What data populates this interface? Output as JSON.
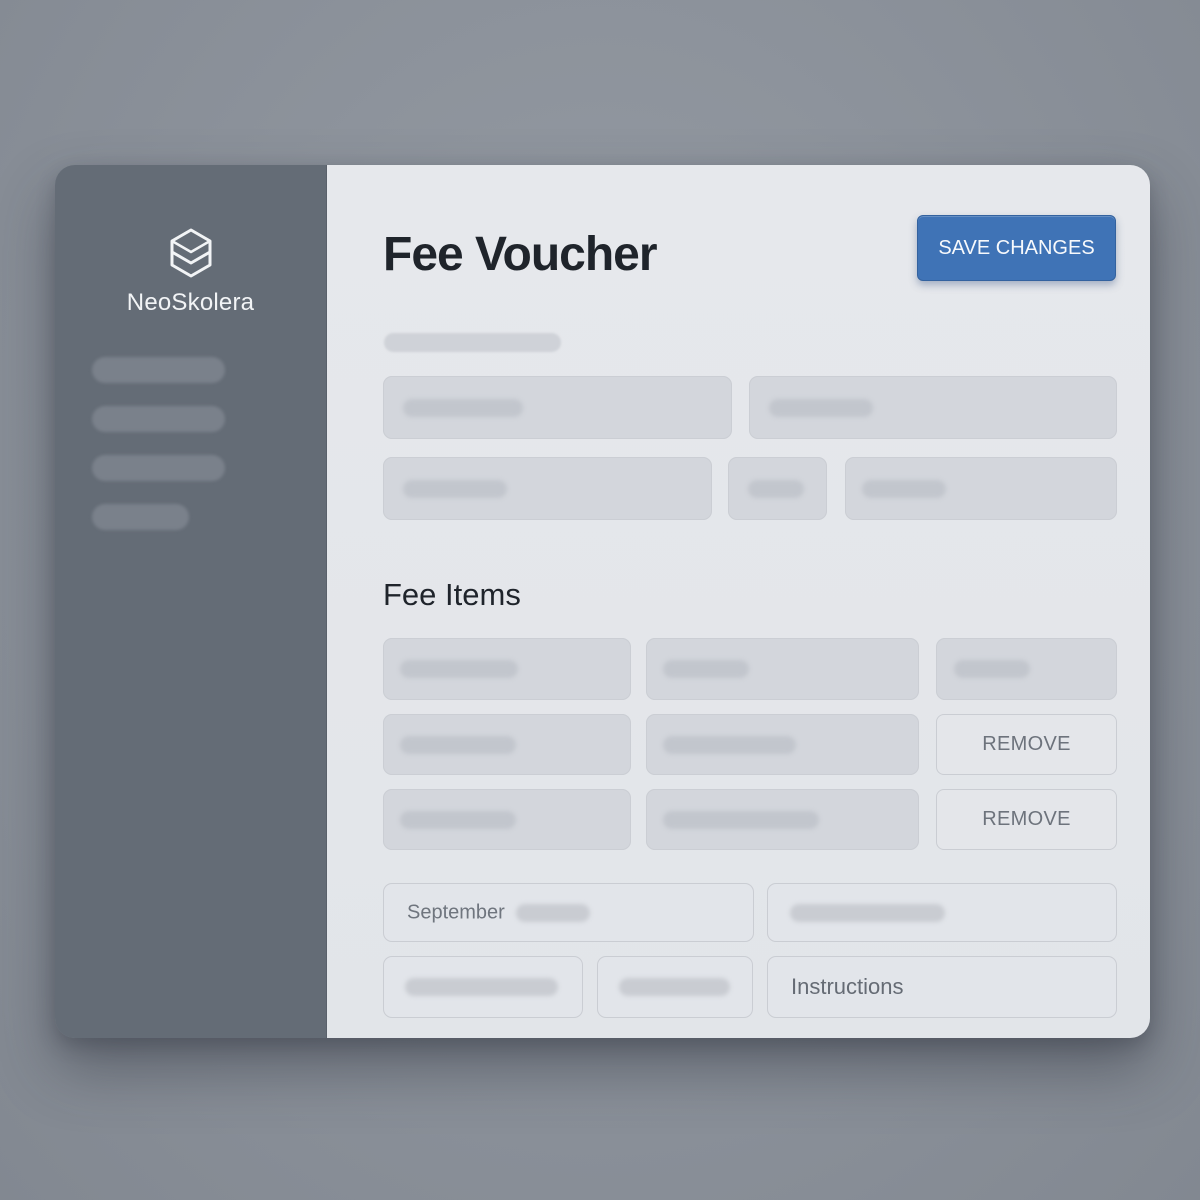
{
  "app": {
    "brand_name": "NeoSkolera",
    "logo_icon": "hexagon-cube-icon"
  },
  "sidebar": {
    "items": [
      {
        "label": ""
      },
      {
        "label": ""
      },
      {
        "label": ""
      },
      {
        "label": ""
      }
    ]
  },
  "header": {
    "title": "Fee Voucher",
    "save_label": "SAVE CHANGES"
  },
  "voucher_fields": {
    "month_value": "September",
    "instructions_placeholder": "Instructions"
  },
  "fee_items": {
    "title": "Fee Items",
    "rows": [
      {
        "remove_label": ""
      },
      {
        "remove_label": "REMOVE"
      },
      {
        "remove_label": "REMOVE"
      }
    ]
  },
  "colors": {
    "accent": "#3f73b6",
    "sidebar_bg": "#646c76",
    "content_bg": "#e4e6ea"
  }
}
